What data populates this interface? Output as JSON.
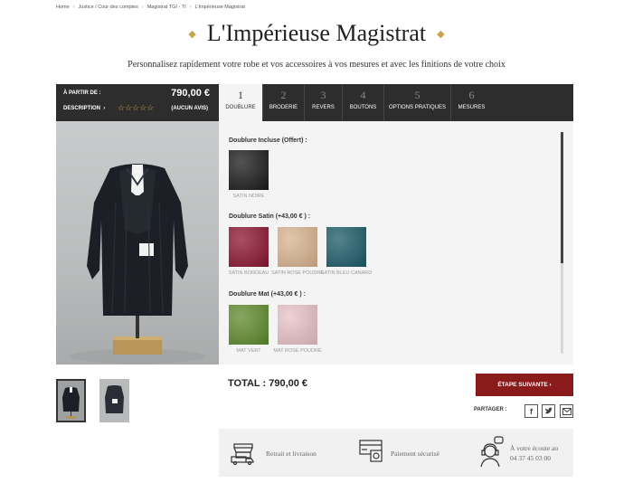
{
  "breadcrumb": [
    "Home",
    "Justice / Cour des comptes",
    "Magistrat TGI - TI",
    "L'Impérieuse Magistrat"
  ],
  "page": {
    "title": "L'Impérieuse Magistrat",
    "subtitle": "Personnalisez rapidement votre robe et vos accessoires à vos mesures et avec les finitions de votre choix"
  },
  "price_bar": {
    "from_label": "À PARTIR DE :",
    "price": "790,00 €",
    "description_label": "DESCRIPTION",
    "description_arrow": "›",
    "stars": "☆☆☆☆☆",
    "reviews": "(AUCUN AVIS)"
  },
  "tabs": [
    {
      "num": "1",
      "label": "DOUBLURE",
      "active": true
    },
    {
      "num": "2",
      "label": "BRODERIE",
      "active": false
    },
    {
      "num": "3",
      "label": "REVERS",
      "active": false
    },
    {
      "num": "4",
      "label": "BOUTONS",
      "active": false
    },
    {
      "num": "5",
      "label": "OPTIONS PRATIQUES",
      "active": false
    },
    {
      "num": "6",
      "label": "MESURES",
      "active": false
    }
  ],
  "options": {
    "sections": [
      {
        "title": "Doublure Incluse (Offert) :",
        "swatches": [
          {
            "label": "SATIN NOIRE",
            "color": "#1a1a1a"
          }
        ]
      },
      {
        "title": "Doublure Satin (+43,00 € ) :",
        "swatches": [
          {
            "label": "SATIN BORDEAU",
            "color": "#8b1530"
          },
          {
            "label": "SATIN ROSE POUDRÉ",
            "color": "#d9b48f"
          },
          {
            "label": "SATIN BLEU CANARD",
            "color": "#1b5b68"
          }
        ]
      },
      {
        "title": "Doublure Mat (+43,00 € ) :",
        "swatches": [
          {
            "label": "MAT VERT",
            "color": "#5e8a2c"
          },
          {
            "label": "MAT ROSE POUDRÉ",
            "color": "#e8c3c8"
          }
        ]
      }
    ]
  },
  "total": {
    "label": "TOTAL : 790,00 €"
  },
  "next_button": {
    "label": "ÉTAPE SUIVANTE ›"
  },
  "share": {
    "label": "PARTAGER :",
    "icons": [
      "facebook-icon",
      "twitter-icon",
      "email-icon"
    ]
  },
  "services": [
    {
      "label": "Retrait et livraison",
      "icon": "store-truck-icon"
    },
    {
      "label": "Paiement sécurisé",
      "icon": "secure-payment-icon"
    },
    {
      "line1": "À votre écoute au",
      "line2": "04 37 45 03 00",
      "icon": "support-headset-icon"
    }
  ],
  "colors": {
    "accent": "#8b1a1a",
    "gold": "#c8a44a",
    "dark_bar": "#2d2d2d"
  }
}
